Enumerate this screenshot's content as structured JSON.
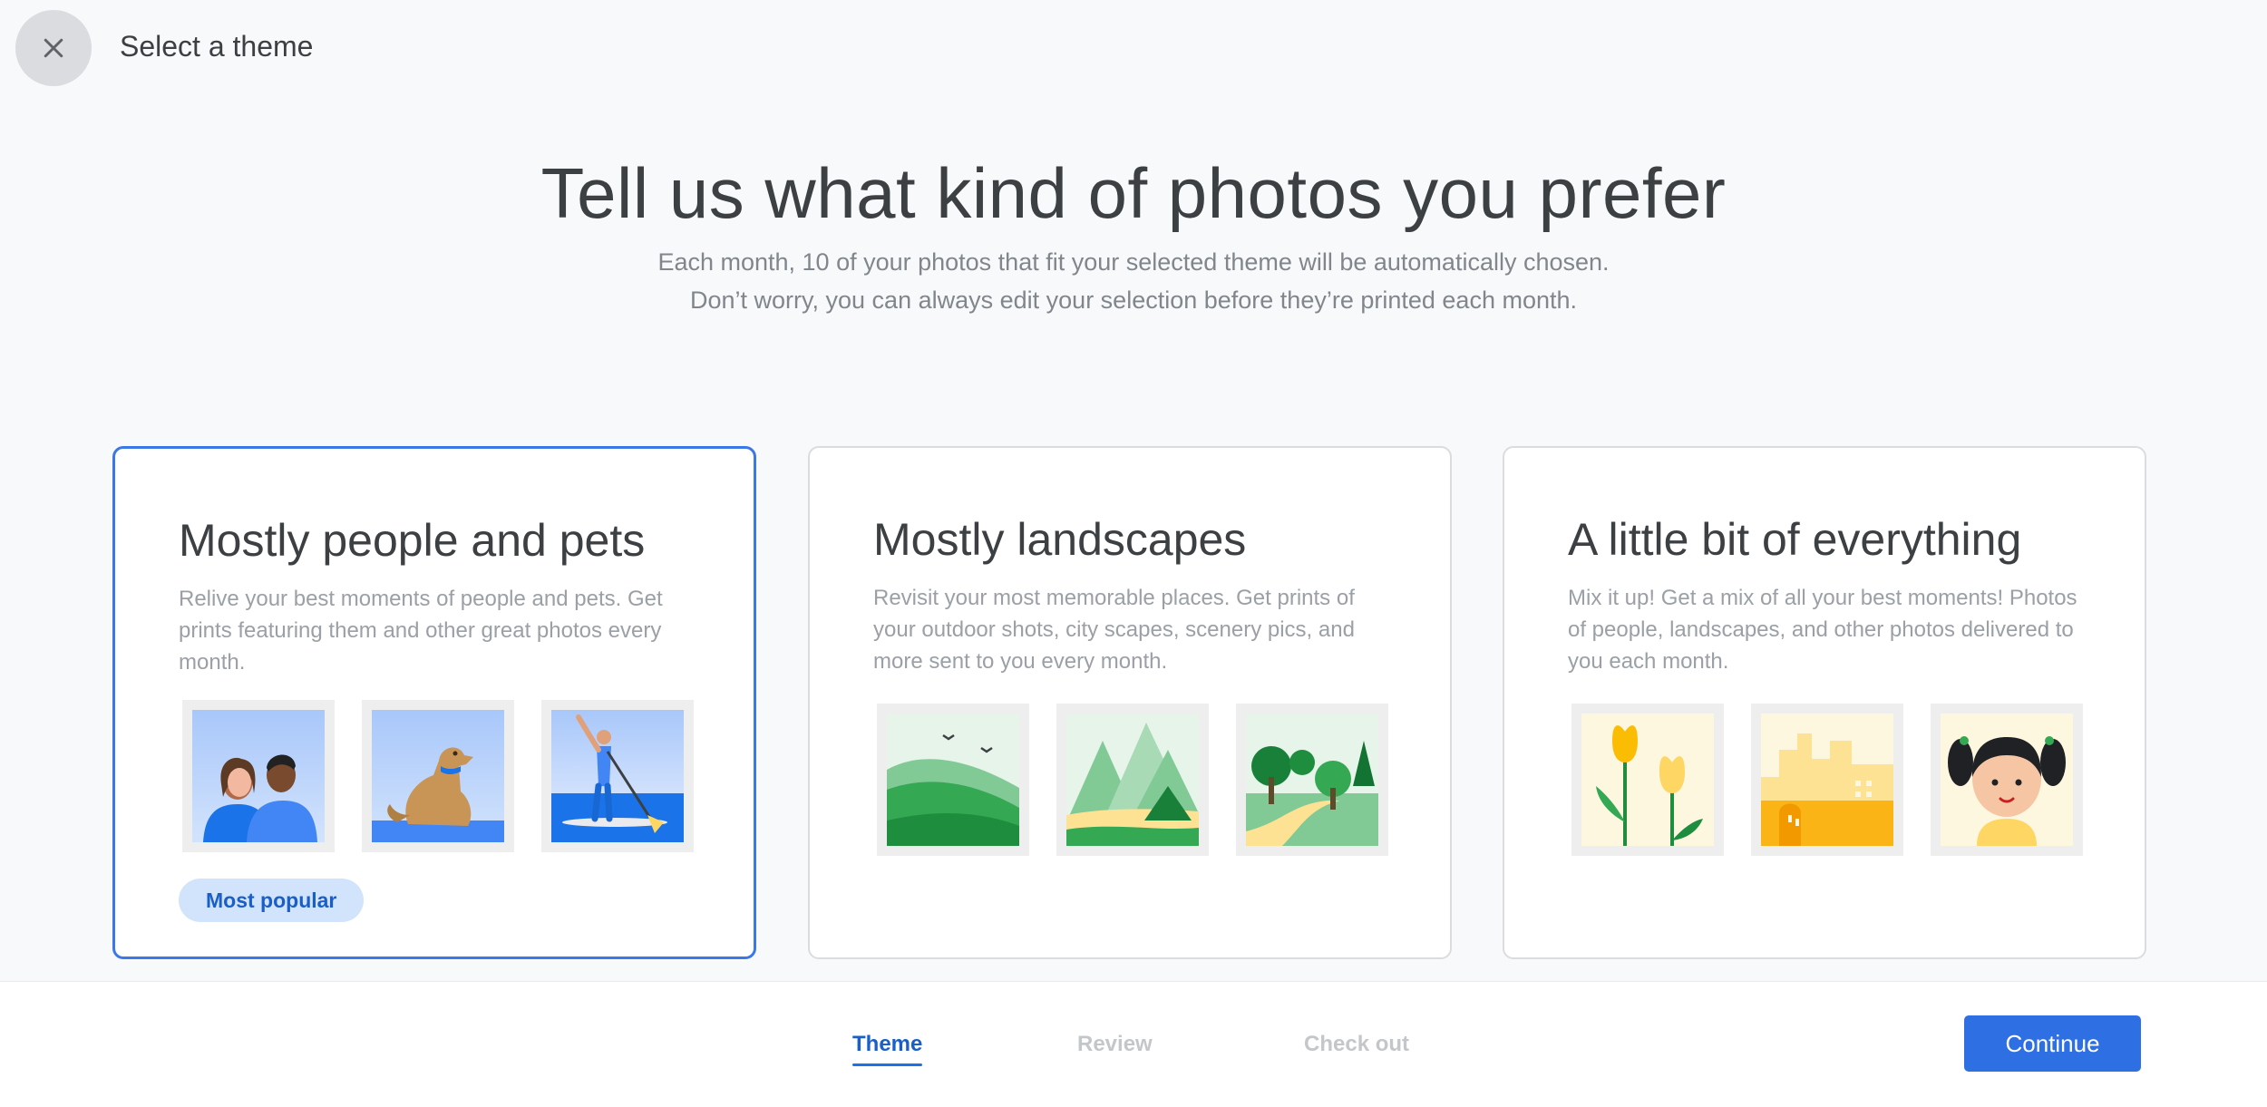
{
  "header": {
    "title": "Select a theme",
    "close_icon": "close-icon"
  },
  "hero": {
    "title": "Tell us what kind of photos you prefer",
    "subtitle_line1": "Each month, 10 of your photos that fit your selected theme will be automatically chosen.",
    "subtitle_line2": "Don’t worry, you can always edit your selection before they’re printed each month."
  },
  "cards": [
    {
      "title": "Mostly people and pets",
      "description": "Relive your best moments of people and pets. Get prints featuring them and other great photos every month.",
      "selected": true,
      "badge": "Most popular",
      "thumbnails": [
        "couple-illustration",
        "dog-illustration",
        "paddleboard-illustration"
      ]
    },
    {
      "title": "Mostly landscapes",
      "description": "Revisit your most memorable places. Get prints of your outdoor shots, city scapes, scenery pics, and more sent to you every month.",
      "selected": false,
      "thumbnails": [
        "hills-illustration",
        "mountains-tent-illustration",
        "forest-path-illustration"
      ]
    },
    {
      "title": "A little bit of everything",
      "description": "Mix it up! Get a mix of all your best moments! Photos of people, landscapes, and other photos delivered to you each month.",
      "selected": false,
      "thumbnails": [
        "tulips-illustration",
        "city-illustration",
        "girl-portrait-illustration"
      ]
    }
  ],
  "footer": {
    "steps": [
      "Theme",
      "Review",
      "Check out"
    ],
    "active_step": "Theme",
    "continue_label": "Continue"
  },
  "colors": {
    "accent": "#1a73e8",
    "button": "#2f6fe4",
    "badge_bg": "#d2e3fc"
  }
}
